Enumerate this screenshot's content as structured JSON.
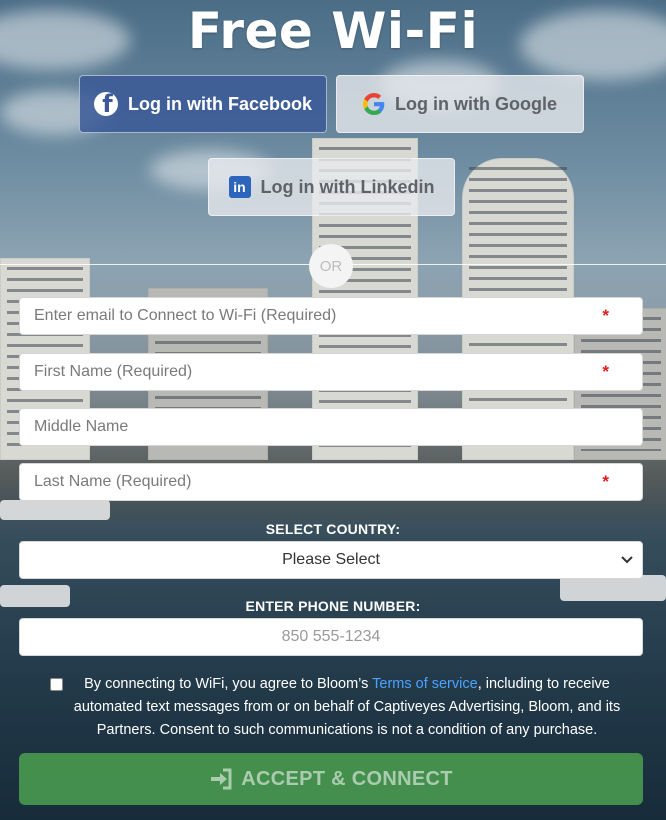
{
  "page": {
    "title": "Free Wi-Fi"
  },
  "social": {
    "facebook_label": "Log in with Facebook",
    "google_label": "Log in with Google",
    "linkedin_label": "Log in with Linkedin",
    "facebook_color": "#3b5998",
    "linkedin_color": "#2d64bc"
  },
  "divider": {
    "or_label": "OR"
  },
  "form": {
    "email_placeholder": "Enter email to Connect to Wi-Fi (Required)",
    "first_name_placeholder": "First Name (Required)",
    "middle_name_placeholder": "Middle Name",
    "last_name_placeholder": "Last Name (Required)",
    "required_marker": "*",
    "country_label": "SELECT COUNTRY:",
    "country_value": "Please Select",
    "phone_label": "ENTER PHONE NUMBER:",
    "phone_placeholder": "850 555-1234"
  },
  "consent": {
    "text_before": "By connecting to WiFi, you agree to Bloom’s ",
    "link_text": "Terms of service",
    "text_after": ", including to receive automated text messages from or on behalf of Captiveyes Advertising, Bloom, and its Partners. Consent to such communications is not a condition of any purchase."
  },
  "submit": {
    "label": "ACCEPT & CONNECT",
    "color": "#4ca050"
  }
}
